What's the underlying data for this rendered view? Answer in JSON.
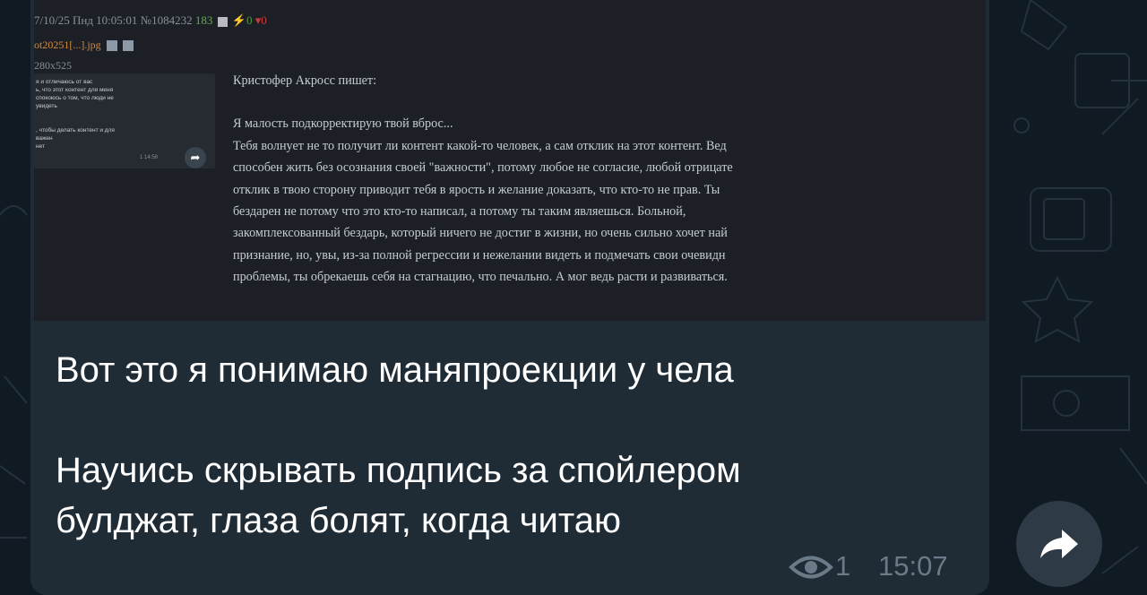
{
  "post": {
    "header": {
      "datetime": "7/10/25 Пнд 10:05:01",
      "number": "№1084232",
      "views": "183",
      "upvotes": "0",
      "downvotes": "0"
    },
    "filename": "ot20251[...].jpg",
    "dimensions": "280x525",
    "thumbnail_lines": [
      "я и отличаюсь от вас",
      "ь, что этот контент для меня",
      "спокоюсь о том, что люди не",
      "увидеть",
      "",
      ", чтобы делать контент и для",
      "важен",
      "нет"
    ],
    "thumbnail_meta": "1  14:58",
    "quote_author": "Кристофер Акросс пишет:",
    "quote_lines": [
      "Я малость подкорректирую твой вброс...",
      "Тебя волнует не то получит ли контент какой-то человек, а сам отклик на этот контент. Вед",
      "способен жить без осознания своей \"важности\", потому любое не согласие, любой отрицате",
      "отклик в твою сторону приводит тебя в ярость и желание доказать, что кто-то не прав. Ты",
      "бездарен не потому что это кто-то написал, а потому ты таким являешься. Больной,",
      "закомплексованный бездарь, который ничего не достиг в жизни, но очень сильно хочет най",
      "признание, но, увы, из-за полной регрессии и нежелании видеть и подмечать свои очевидн",
      "проблемы, ты обрекаешь себя на стагнацию, что печально. А мог ведь расти и развиваться."
    ]
  },
  "message": {
    "line1": "Вот это я понимаю маняпроекции у чела",
    "line2": "Научись скрывать подпись за спойлером",
    "line3": "булджат, глаза болят, когда читаю",
    "views": "1",
    "time": "15:07"
  },
  "icons": {
    "eye": "eye-icon",
    "share": "share-arrow-icon"
  },
  "colors": {
    "bubble": "#1f2b35",
    "background": "#0f1a22",
    "meta": "#6b7a88"
  }
}
